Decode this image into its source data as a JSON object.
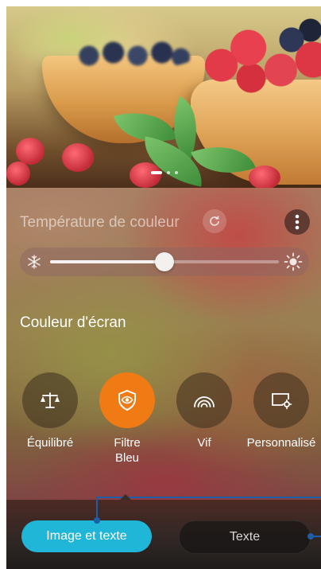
{
  "color_temperature": {
    "title": "Température de couleur",
    "slider_level_percent": 50,
    "cold_icon": "snowflake-icon",
    "warm_icon": "sun-icon",
    "reset_icon": "refresh-icon",
    "more_icon": "more-vertical-icon"
  },
  "screen_color": {
    "title": "Couleur d'écran",
    "modes": [
      {
        "label": "Équilibré",
        "icon": "balance-scale-icon",
        "selected": false
      },
      {
        "label": "Filtre\nBleu",
        "icon": "eye-shield-icon",
        "selected": true
      },
      {
        "label": "Vif",
        "icon": "signal-arcs-icon",
        "selected": false
      },
      {
        "label": "Personnalisé",
        "icon": "display-settings-icon",
        "selected": false
      }
    ]
  },
  "preview_tabs": {
    "image_text_label": "Image et texte",
    "text_label": "Texte"
  },
  "colors": {
    "accent_orange": "#f07a14",
    "accent_cyan": "#1fb6d8",
    "callout_blue": "#1d5ea8"
  }
}
